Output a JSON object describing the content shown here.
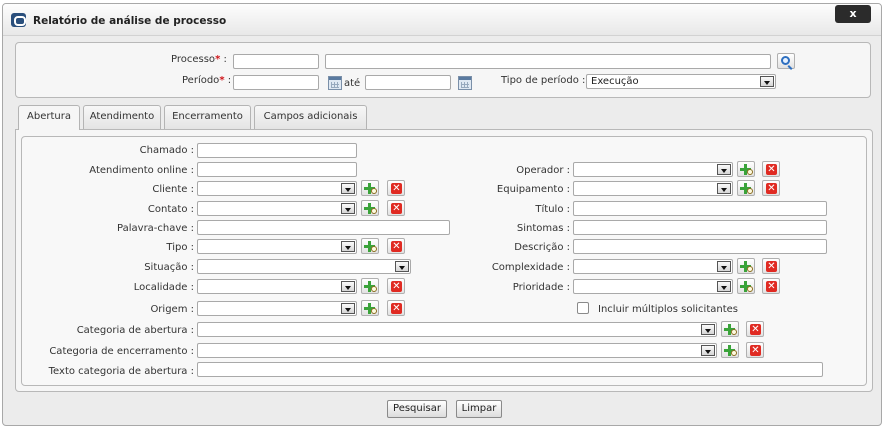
{
  "window": {
    "title": "Relatório de análise de processo",
    "close_label": "x"
  },
  "header_form": {
    "processo_label": "Processo",
    "periodo_label": "Período",
    "ate_label": "até",
    "tipo_periodo_label": "Tipo de período :",
    "tipo_periodo_value": "Execução",
    "required_mark": "*",
    "colon": ":"
  },
  "tabs": [
    {
      "label": "Abertura",
      "active": true
    },
    {
      "label": "Atendimento",
      "active": false
    },
    {
      "label": "Encerramento",
      "active": false
    },
    {
      "label": "Campos adicionais",
      "active": false
    }
  ],
  "fields": {
    "chamado": "Chamado :",
    "atendimento_online": "Atendimento online :",
    "cliente": "Cliente :",
    "contato": "Contato :",
    "palavra_chave": "Palavra-chave :",
    "tipo": "Tipo :",
    "situacao": "Situação :",
    "localidade": "Localidade :",
    "origem": "Origem :",
    "operador": "Operador :",
    "equipamento": "Equipamento :",
    "titulo": "Título :",
    "sintomas": "Sintomas :",
    "descricao": "Descrição :",
    "complexidade": "Complexidade :",
    "prioridade": "Prioridade :",
    "incluir_multiplos": "Incluir múltiplos solicitantes",
    "categoria_abertura": "Categoria de abertura :",
    "categoria_encerramento": "Categoria de encerramento :",
    "texto_categoria_abertura": "Texto categoria de abertura :"
  },
  "buttons": {
    "pesquisar": "Pesquisar",
    "limpar": "Limpar"
  },
  "icons": {
    "add": "add-search-icon",
    "remove": "remove-icon",
    "search": "search-icon",
    "calendar": "calendar-icon",
    "dropdown": "chevron-down-icon"
  },
  "colors": {
    "required": "#d0161a",
    "add_green": "#3aa33a",
    "remove_red": "#e02a22",
    "title_bar_close": "#2b2b2b"
  }
}
